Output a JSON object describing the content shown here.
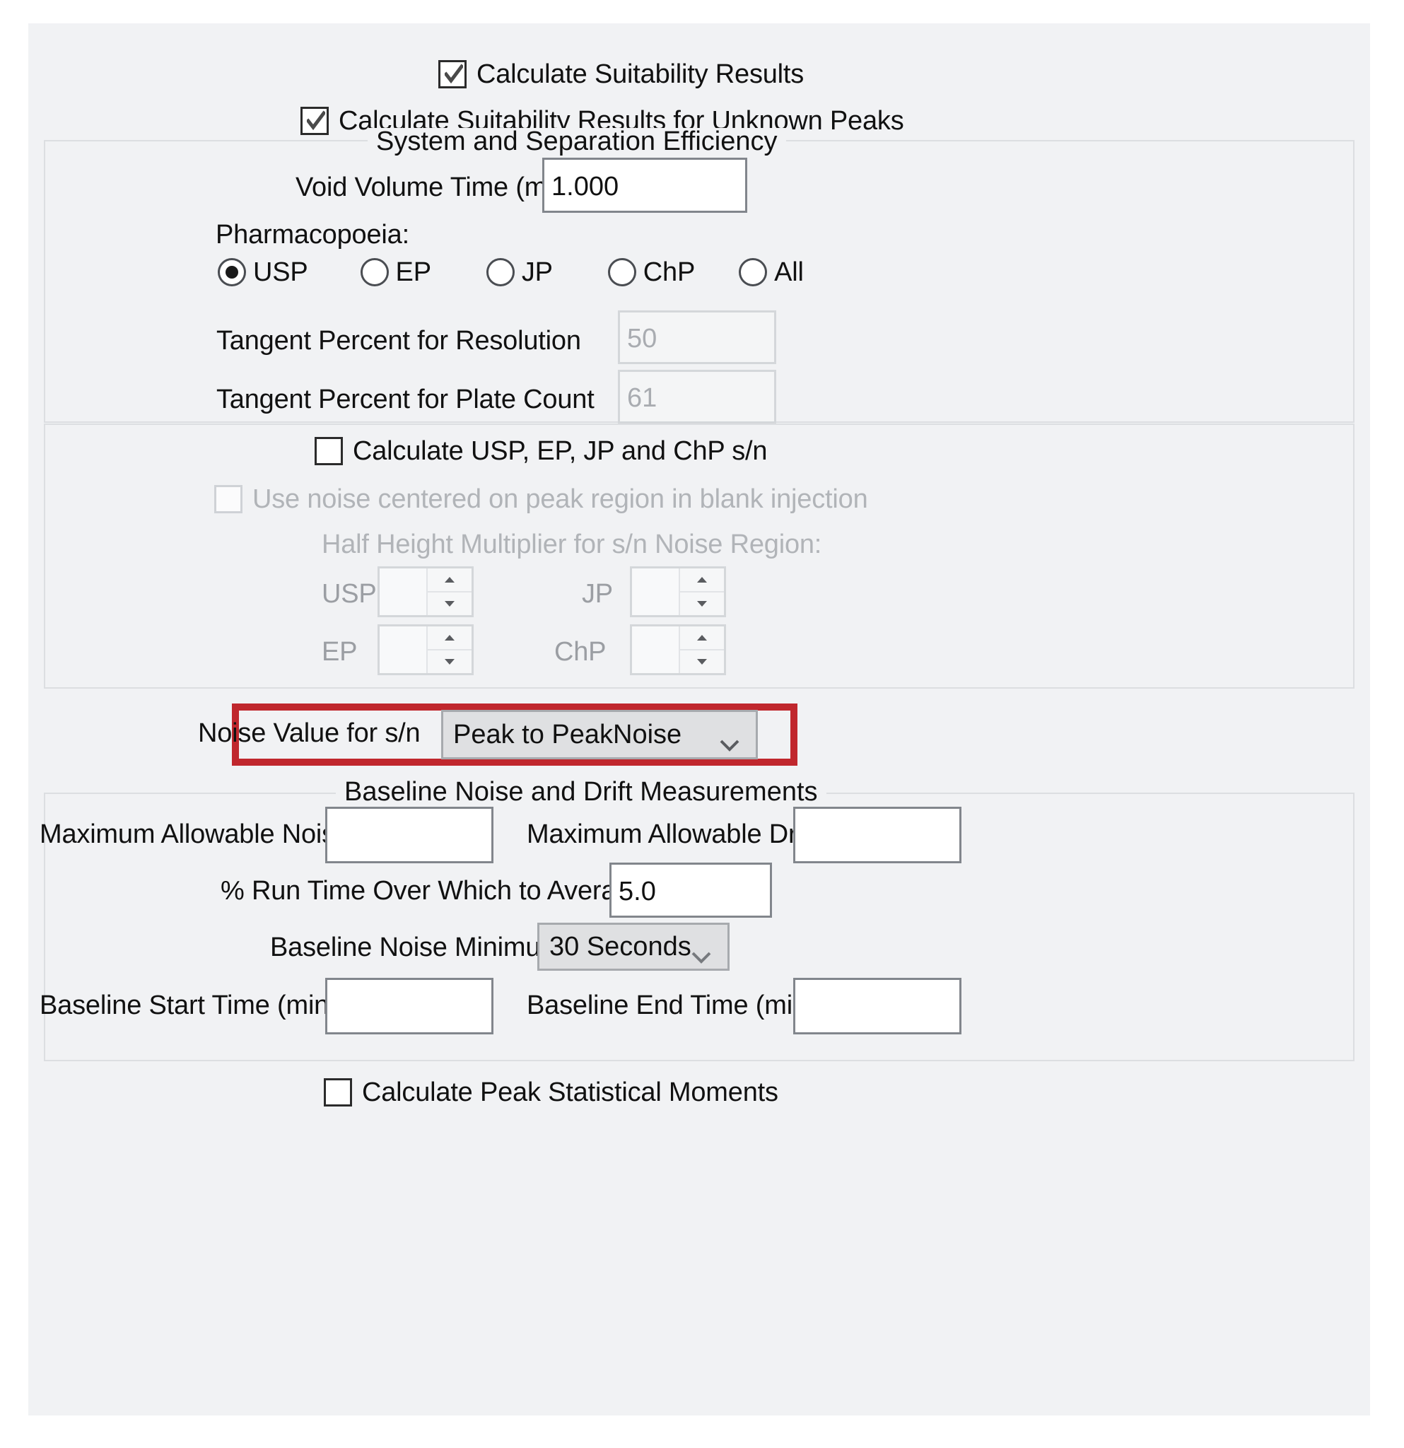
{
  "dialog": {
    "background_color": "#f1f2f4",
    "highlight_color": "#c0272d"
  },
  "top_checkboxes": [
    {
      "label": "Calculate Suitability Results",
      "checked": true,
      "enabled": true
    },
    {
      "label": "Calculate Suitability Results for Unknown Peaks",
      "checked": true,
      "enabled": true
    }
  ],
  "system_separation_efficiency": {
    "title": "System and Separation Efficiency",
    "void_volume_time": {
      "label": "Void Volume Time (min)",
      "value": "1.000"
    },
    "pharmacopoeia": {
      "label": "Pharmacopoeia:",
      "options": [
        "USP",
        "EP",
        "JP",
        "ChP",
        "All"
      ],
      "selected": "USP"
    },
    "tangent_percent_resolution": {
      "label": "Tangent Percent for Resolution",
      "value": "50",
      "enabled": false
    },
    "tangent_percent_plate_count": {
      "label": "Tangent Percent for Plate Count",
      "value": "61",
      "enabled": false
    }
  },
  "sn_section": {
    "calculate_sn": {
      "label": "Calculate USP, EP, JP and ChP s/n",
      "checked": false,
      "enabled": true
    },
    "use_noise_blank": {
      "label": "Use noise centered on peak region in blank injection",
      "checked": false,
      "enabled": false
    },
    "half_height_label": "Half Height Multiplier for s/n Noise Region:",
    "multipliers": [
      {
        "label": "USP",
        "value": "",
        "enabled": false
      },
      {
        "label": "JP",
        "value": "",
        "enabled": false
      },
      {
        "label": "EP",
        "value": "",
        "enabled": false
      },
      {
        "label": "ChP",
        "value": "",
        "enabled": false
      }
    ]
  },
  "noise_value": {
    "label": "Noise Value for s/n",
    "selected": "Peak to PeakNoise",
    "highlighted": true
  },
  "baseline_section": {
    "title": "Baseline Noise and Drift Measurements",
    "maximum_allowable_noise": {
      "label": "Maximum Allowable Noise",
      "value": ""
    },
    "maximum_allowable_drift": {
      "label": "Maximum Allowable Drift",
      "value": ""
    },
    "run_time_average": {
      "label": "% Run Time Over Which to Average",
      "value": "5.0"
    },
    "baseline_noise_minimum": {
      "label": "Baseline Noise Minimum",
      "selected": "30 Seconds"
    },
    "baseline_start_time": {
      "label": "Baseline Start Time (min)",
      "value": ""
    },
    "baseline_end_time": {
      "label": "Baseline End Time (min)",
      "value": ""
    }
  },
  "bottom_checkbox": {
    "label": "Calculate Peak Statistical Moments",
    "checked": false,
    "enabled": true
  }
}
